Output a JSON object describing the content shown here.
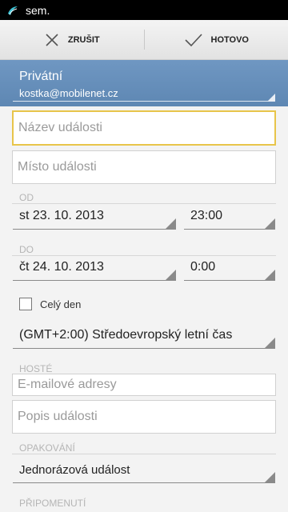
{
  "status_bar": {
    "text": "sem."
  },
  "action_bar": {
    "cancel_label": "ZRUŠIT",
    "done_label": "HOTOVO"
  },
  "account": {
    "name": "Privátní",
    "email": "kostka@mobilenet.cz"
  },
  "fields": {
    "title_placeholder": "Název události",
    "location_placeholder": "Místo události",
    "description_placeholder": "Popis události"
  },
  "from": {
    "label": "OD",
    "date": "st 23. 10. 2013",
    "time": "23:00"
  },
  "to": {
    "label": "DO",
    "date": "čt 24. 10. 2013",
    "time": "0:00"
  },
  "all_day": {
    "label": "Celý den",
    "checked": false
  },
  "timezone": {
    "value": "(GMT+2:00) Středoevropský letní čas"
  },
  "guests": {
    "label": "HOSTÉ",
    "placeholder": "E-mailové adresy"
  },
  "repeat": {
    "label": "OPAKOVÁNÍ",
    "value": "Jednorázová událost"
  },
  "reminders": {
    "label": "PŘIPOMENUTÍ"
  },
  "colors": {
    "account_bg": "#6288b3",
    "focus_border": "#e8c54a"
  }
}
